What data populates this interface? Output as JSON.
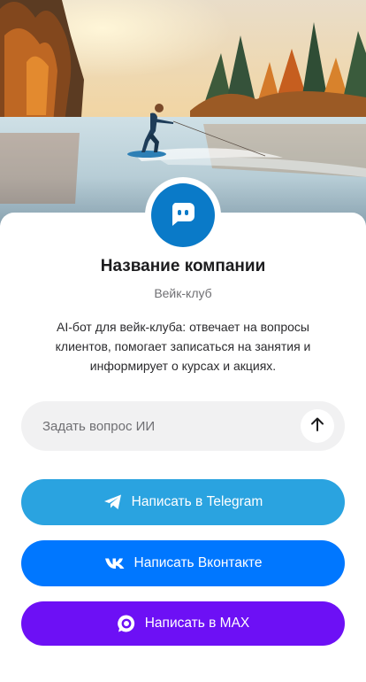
{
  "company": {
    "name": "Название компании",
    "type": "Вейк-клуб",
    "description": "AI-бот для вейк-клуба: отвечает на вопросы клиентов, помогает записаться на занятия и информирует о курсах и акциях."
  },
  "ask": {
    "placeholder": "Задать вопрос ИИ",
    "value": ""
  },
  "buttons": [
    {
      "label": "Написать в Telegram",
      "icon": "telegram-icon",
      "color": "#2aa3e0"
    },
    {
      "label": "Написать Вконтакте",
      "icon": "vk-icon",
      "color": "#0077ff"
    },
    {
      "label": "Написать в MAX",
      "icon": "max-icon",
      "color": "#6d10f5"
    }
  ],
  "colors": {
    "avatar": "#0a7ac8",
    "ask_box": "#f1f1f2"
  },
  "icons": {
    "avatar": "chat-bot-icon",
    "send": "arrow-up-icon"
  }
}
